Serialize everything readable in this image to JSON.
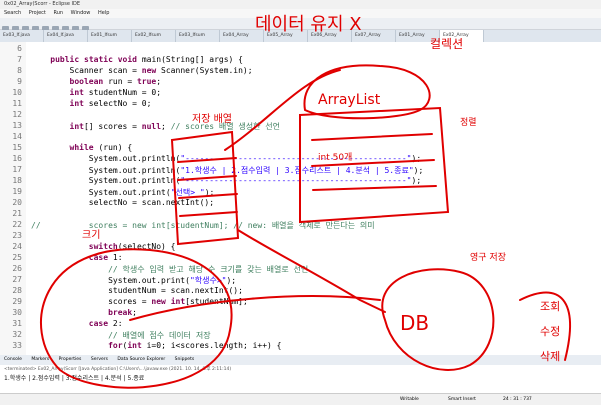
{
  "window": {
    "title": "0x02_Array(Scorr - Eclipse IDE"
  },
  "menu": [
    "Search",
    "Project",
    "Run",
    "Window",
    "Help"
  ],
  "tabs": [
    "Ex03_If.java",
    "Ex04_If.java",
    "Ex01_Ifsum",
    "Ex02_Ifsum",
    "Ex03_Ifsum",
    "Ex04_Array",
    "Ex05_Array",
    "Ex06_Array",
    "Ex07_Array",
    "Ex01_Array",
    "Ex02_Array"
  ],
  "lines": [
    {
      "n": "6",
      "code": ""
    },
    {
      "n": "7",
      "code": "    public static void main(String[] args) {"
    },
    {
      "n": "8",
      "code": "        Scanner scan = new Scanner(System.in);"
    },
    {
      "n": "9",
      "code": "        boolean run = true;"
    },
    {
      "n": "10",
      "code": "        int studentNum = 0;"
    },
    {
      "n": "11",
      "code": "        int selectNo = 0;"
    },
    {
      "n": "12",
      "code": ""
    },
    {
      "n": "13",
      "code": "        int[] scores = null; // scores 배열 생성한 선언"
    },
    {
      "n": "14",
      "code": ""
    },
    {
      "n": "15",
      "code": "        while (run) {"
    },
    {
      "n": "16",
      "code": "            System.out.println(\"----------------------------------------------\");"
    },
    {
      "n": "17",
      "code": "            System.out.println(\"1.학생수 | 2.점수입력 | 3.점수리스트 | 4.분석 | 5.종료\");"
    },
    {
      "n": "18",
      "code": "            System.out.println(\"----------------------------------------------\");"
    },
    {
      "n": "19",
      "code": "            System.out.print(\"선택> \");"
    },
    {
      "n": "20",
      "code": "            selectNo = scan.nextInt();"
    },
    {
      "n": "21",
      "code": ""
    },
    {
      "n": "22",
      "code": "//          scores = new int[studentNum]; // new: 배열을 객체로 만든다는 의미"
    },
    {
      "n": "23",
      "code": ""
    },
    {
      "n": "24",
      "code": "            switch(selectNo) {"
    },
    {
      "n": "25",
      "code": "            case 1:"
    },
    {
      "n": "26",
      "code": "                // 학생수 입력 받고 해당 수 크기를 갖는 배열로 선언"
    },
    {
      "n": "27",
      "code": "                System.out.print(\"학생수>\");"
    },
    {
      "n": "28",
      "code": "                studentNum = scan.nextInt();"
    },
    {
      "n": "29",
      "code": "                scores = new int[studentNum];"
    },
    {
      "n": "30",
      "code": "                break;"
    },
    {
      "n": "31",
      "code": "            case 2:"
    },
    {
      "n": "32",
      "code": "                // 배열에 점수 데이터 저장"
    },
    {
      "n": "33",
      "code": "                for(int i=0; i<scores.length; i++) {"
    }
  ],
  "console": {
    "tabs": [
      "Console",
      "Markers",
      "Properties",
      "Servers",
      "Data Source Explorer",
      "Snippets"
    ],
    "terminated": "<terminated> Ex02_Array(Scorr [Java Application] C:\\Users\\...\\javaw.exe (2021. 10. 14. 오후 2:11:14)",
    "output": "1.학생수 | 2.점수입력 | 3.점수리스트 | 4.분석 | 5.종료"
  },
  "status": {
    "writable": "Writable",
    "insert": "Smart Insert",
    "position": "24 : 31 : 737"
  },
  "annotations": [
    "데이터 유지 X",
    "ArrayList",
    "컬렉션",
    "저장 배열",
    "DB",
    "영구 저장",
    "정렬",
    "조회",
    "수정",
    "삭제",
    "크기",
    "int 50개"
  ],
  "colors": {
    "ink": "#e00000",
    "keyword": "#7f0055",
    "string": "#2a00ff",
    "comment": "#3f7f5f"
  }
}
